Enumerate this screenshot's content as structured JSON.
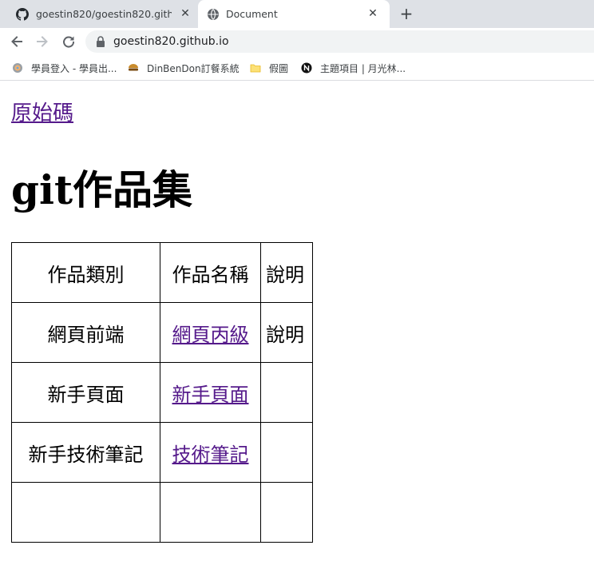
{
  "browser": {
    "tabs": [
      {
        "title": "goestin820/goestin820.github.io",
        "favicon": "github-icon",
        "active": false
      },
      {
        "title": "Document",
        "favicon": "globe-icon",
        "active": true
      }
    ],
    "new_tab": "+",
    "close_symbol": "✕",
    "url": "goestin820.github.io",
    "bookmarks": [
      {
        "label": "學員登入 - 學員出...",
        "icon": "site-icon"
      },
      {
        "label": "DinBenDon訂餐系統",
        "icon": "food-icon"
      },
      {
        "label": "假圖",
        "icon": "folder-icon"
      },
      {
        "label": "主題項目 | 月光林...",
        "icon": "notion-icon"
      }
    ]
  },
  "page": {
    "source_link": "原始碼",
    "title": "git作品集",
    "table": {
      "headers": [
        "作品類別",
        "作品名稱",
        "說明"
      ],
      "rows": [
        {
          "category": "網頁前端",
          "name": "網頁丙級",
          "name_is_link": true,
          "note": "說明"
        },
        {
          "category": "新手頁面",
          "name": "新手頁面",
          "name_is_link": true,
          "note": ""
        },
        {
          "category": "新手技術筆記",
          "name": "技術筆記",
          "name_is_link": true,
          "note": ""
        },
        {
          "category": "",
          "name": "",
          "name_is_link": false,
          "note": ""
        }
      ]
    }
  },
  "colors": {
    "tab_strip": "#dee1e6",
    "omnibox": "#f1f3f4",
    "visited_link": "#551a8b"
  }
}
